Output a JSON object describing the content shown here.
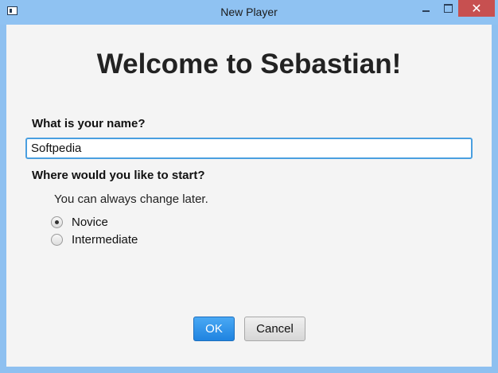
{
  "window": {
    "title": "New Player",
    "controls": {
      "minimize": "minimize",
      "maximize": "maximize",
      "close": "✕"
    }
  },
  "heading": "Welcome to Sebastian!",
  "name_section": {
    "label": "What is your name?",
    "value": "Softpedia"
  },
  "start_section": {
    "label": "Where would you like to start?",
    "hint": "You can always change later.",
    "options": [
      {
        "label": "Novice",
        "selected": true
      },
      {
        "label": "Intermediate",
        "selected": false
      }
    ]
  },
  "buttons": {
    "ok": "OK",
    "cancel": "Cancel"
  },
  "colors": {
    "titlebar": "#8fc2f2",
    "close_button": "#c75050",
    "content_bg": "#f4f4f4",
    "ok_button": "#2b8de6",
    "focus_border": "#4a9fe0"
  }
}
